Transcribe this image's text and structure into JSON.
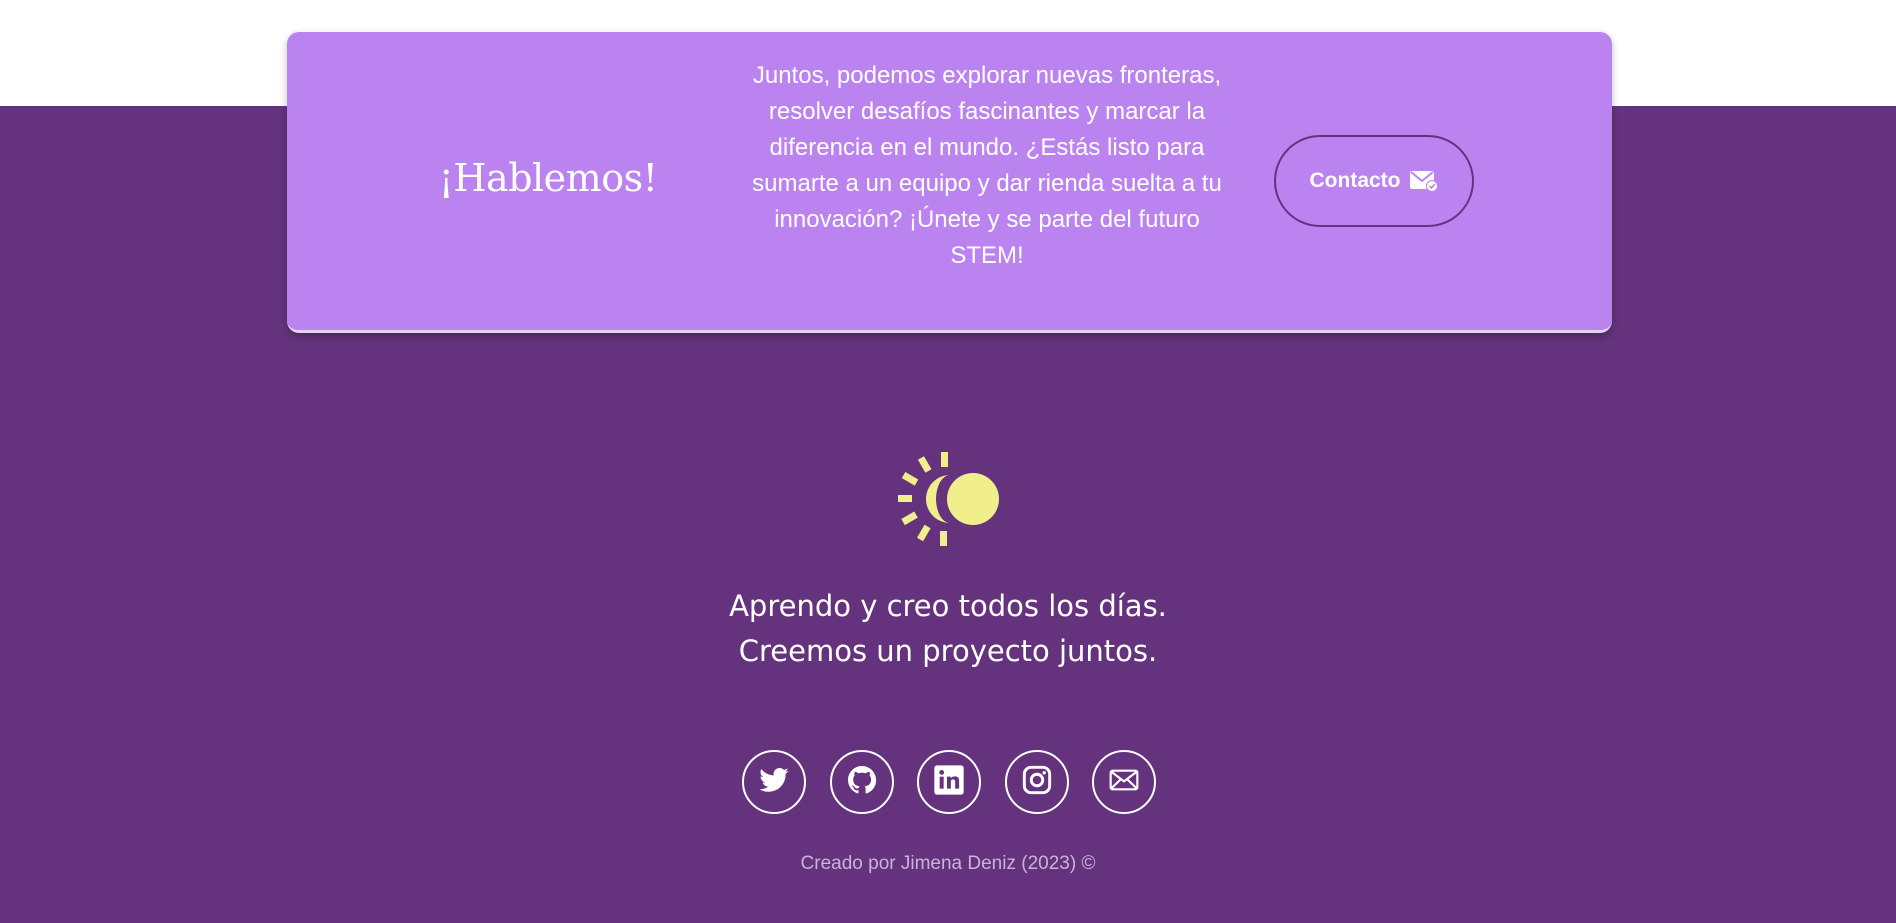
{
  "cta": {
    "title": "¡Hablemos!",
    "text": "Juntos, podemos explorar nuevas fronteras, resolver desafíos fascinantes y marcar la diferencia en el mundo. ¿Estás listo para sumarte a un equipo y dar rienda suelta a tu innovación? ¡Únete y se parte del futuro STEM!",
    "button_label": "Contacto",
    "button_icon": "mail-check-icon"
  },
  "footer": {
    "logo_icon": "sun-icon",
    "tagline_line1": "Aprendo y creo todos los días.",
    "tagline_line2": "Creemos un proyecto juntos.",
    "socials": [
      {
        "name": "twitter",
        "icon": "twitter-icon"
      },
      {
        "name": "github",
        "icon": "github-icon"
      },
      {
        "name": "linkedin",
        "icon": "linkedin-icon"
      },
      {
        "name": "instagram",
        "icon": "instagram-icon"
      },
      {
        "name": "email",
        "icon": "mail-icon"
      }
    ],
    "copyright": "Creado por Jimena Deniz (2023) ©"
  },
  "colors": {
    "footer_bg": "#65337d",
    "card_bg": "#bb83f0",
    "logo_yellow": "#f0ef8c",
    "text": "#ffffff",
    "copyright_text": "#c9b3d6"
  }
}
